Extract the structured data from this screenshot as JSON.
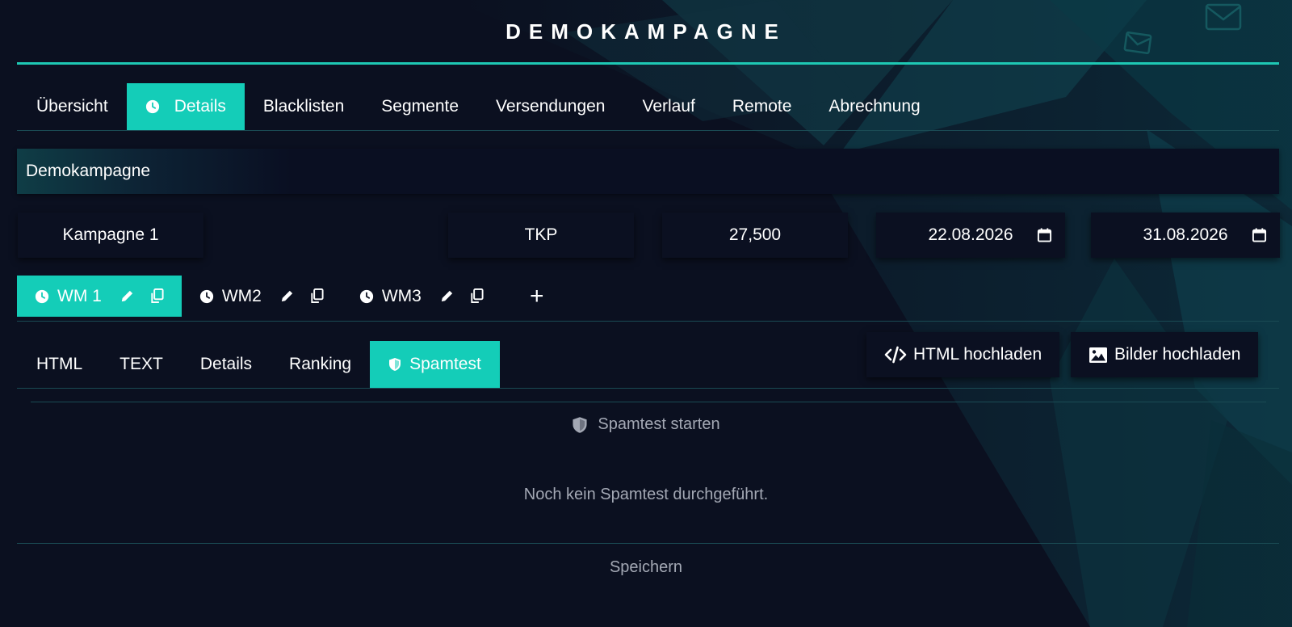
{
  "app": {
    "title": "DEMOKAMPAGNE"
  },
  "main_tabs": [
    {
      "label": "Übersicht",
      "active": false
    },
    {
      "label": "Details",
      "active": true,
      "icon": "clock-icon"
    },
    {
      "label": "Blacklisten",
      "active": false
    },
    {
      "label": "Segmente",
      "active": false
    },
    {
      "label": "Versendungen",
      "active": false
    },
    {
      "label": "Verlauf",
      "active": false
    },
    {
      "label": "Remote",
      "active": false
    },
    {
      "label": "Abrechnung",
      "active": false
    }
  ],
  "campaign": {
    "name": "Demokampagne",
    "title": "Kampagne 1",
    "pricing_model": "TKP",
    "amount": "27,500",
    "start_date": "22.08.2026",
    "end_date": "31.08.2026"
  },
  "mailings": [
    {
      "label": "WM 1",
      "active": true
    },
    {
      "label": "WM2",
      "active": false
    },
    {
      "label": "WM3",
      "active": false
    }
  ],
  "add_label": "+",
  "content_tabs": [
    {
      "label": "HTML",
      "active": false
    },
    {
      "label": "TEXT",
      "active": false
    },
    {
      "label": "Details",
      "active": false
    },
    {
      "label": "Ranking",
      "active": false
    },
    {
      "label": "Spamtest",
      "active": true,
      "icon": "shield-icon"
    }
  ],
  "actions": {
    "html_upload": "HTML hochladen",
    "images_upload": "Bilder hochladen"
  },
  "spamtest": {
    "start_label": "Spamtest starten",
    "empty_message": "Noch kein Spamtest durchgeführt."
  },
  "save_label": "Speichern",
  "colors": {
    "accent": "#14cdb8",
    "background": "#0b1020",
    "panel": "#0b1021",
    "muted_text": "#a3a8b4"
  }
}
